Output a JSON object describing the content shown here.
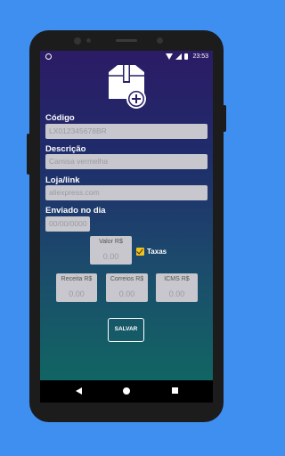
{
  "status_bar": {
    "time": "23:53"
  },
  "form": {
    "codigo": {
      "label": "Código",
      "placeholder": "LX012345678BR"
    },
    "descricao": {
      "label": "Descrição",
      "placeholder": "Camisa vermelha"
    },
    "loja": {
      "label": "Loja/link",
      "placeholder": "aliexpress.com"
    },
    "enviado": {
      "label": "Enviado no dia",
      "placeholder": "00/00/0000"
    }
  },
  "valor": {
    "label": "Valor R$",
    "value": "0.00"
  },
  "taxas": {
    "label": "Taxas",
    "checked": true
  },
  "fees": [
    {
      "label": "Receita R$",
      "value": "0.00"
    },
    {
      "label": "Correios R$",
      "value": "0.00"
    },
    {
      "label": "ICMS R$",
      "value": "0.00"
    }
  ],
  "save_button": {
    "label": "SALVAR"
  },
  "colors": {
    "background": "#3f8ff0",
    "checkbox": "#f2c21a",
    "field": "#c7c7cd"
  },
  "icons": [
    "add-package-icon",
    "wifi-icon",
    "signal-icon",
    "battery-icon",
    "back-icon",
    "home-icon",
    "recent-apps-icon"
  ]
}
